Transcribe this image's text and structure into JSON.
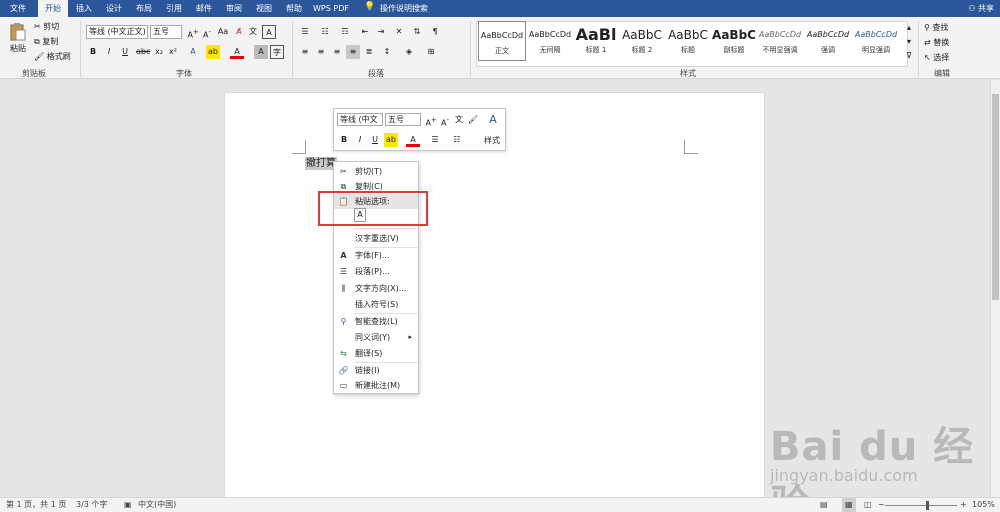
{
  "tabs": [
    "文件",
    "开始",
    "插入",
    "设计",
    "布局",
    "引用",
    "邮件",
    "审阅",
    "视图",
    "帮助",
    "WPS PDF"
  ],
  "tell_me": "操作说明搜索",
  "share": "共享",
  "clipboard": {
    "paste": "粘贴",
    "cut": "剪切",
    "copy": "复制",
    "format_painter": "格式刷",
    "label": "剪贴板"
  },
  "font": {
    "name": "等线 (中文正文)",
    "size": "五号",
    "label": "字体"
  },
  "paragraph": {
    "label": "段落"
  },
  "styles": {
    "label": "样式",
    "items": [
      {
        "sample": "AaBbCcDd",
        "name": "正文"
      },
      {
        "sample": "AaBbCcDd",
        "name": "无间隔"
      },
      {
        "sample": "AaBl",
        "name": "标题 1"
      },
      {
        "sample": "AaBbC",
        "name": "标题 2"
      },
      {
        "sample": "AaBbC",
        "name": "标题"
      },
      {
        "sample": "AaBbC",
        "name": "副标题"
      },
      {
        "sample": "AaBbCcDd",
        "name": "不明显强调"
      },
      {
        "sample": "AaBbCcDd",
        "name": "强调"
      },
      {
        "sample": "AaBbCcDd",
        "name": "明显强调"
      }
    ]
  },
  "editing": {
    "find": "查找",
    "replace": "替换",
    "select": "选择",
    "label": "编辑"
  },
  "document": {
    "selected_text": "撤打算"
  },
  "mini_toolbar": {
    "font": "等线 (中文",
    "size": "五号",
    "styles": "样式"
  },
  "context_menu": {
    "items": [
      {
        "icon": "scissors-icon",
        "label": "剪切(T)"
      },
      {
        "icon": "copy-icon",
        "label": "复制(C)"
      },
      {
        "icon": "paste-icon",
        "label": "粘贴选项:"
      },
      {
        "icon": "",
        "label": "汉字重选(V)"
      },
      {
        "icon": "font-icon",
        "label": "字体(F)..."
      },
      {
        "icon": "paragraph-icon",
        "label": "段落(P)..."
      },
      {
        "icon": "text-direction-icon",
        "label": "文字方向(X)..."
      },
      {
        "icon": "",
        "label": "插入符号(S)"
      },
      {
        "icon": "smart-lookup-icon",
        "label": "智能查找(L)"
      },
      {
        "icon": "",
        "label": "同义词(Y)"
      },
      {
        "icon": "translate-icon",
        "label": "翻译(S)"
      },
      {
        "icon": "link-icon",
        "label": "链接(I)"
      },
      {
        "icon": "comment-icon",
        "label": "新建批注(M)"
      }
    ]
  },
  "status": {
    "page": "第 1 页，共 1 页",
    "words": "3/3 个字",
    "language": "中文(中国)",
    "zoom": "105%"
  },
  "watermark": {
    "brand": "Bai du 经验",
    "url": "jingyan.baidu.com"
  }
}
